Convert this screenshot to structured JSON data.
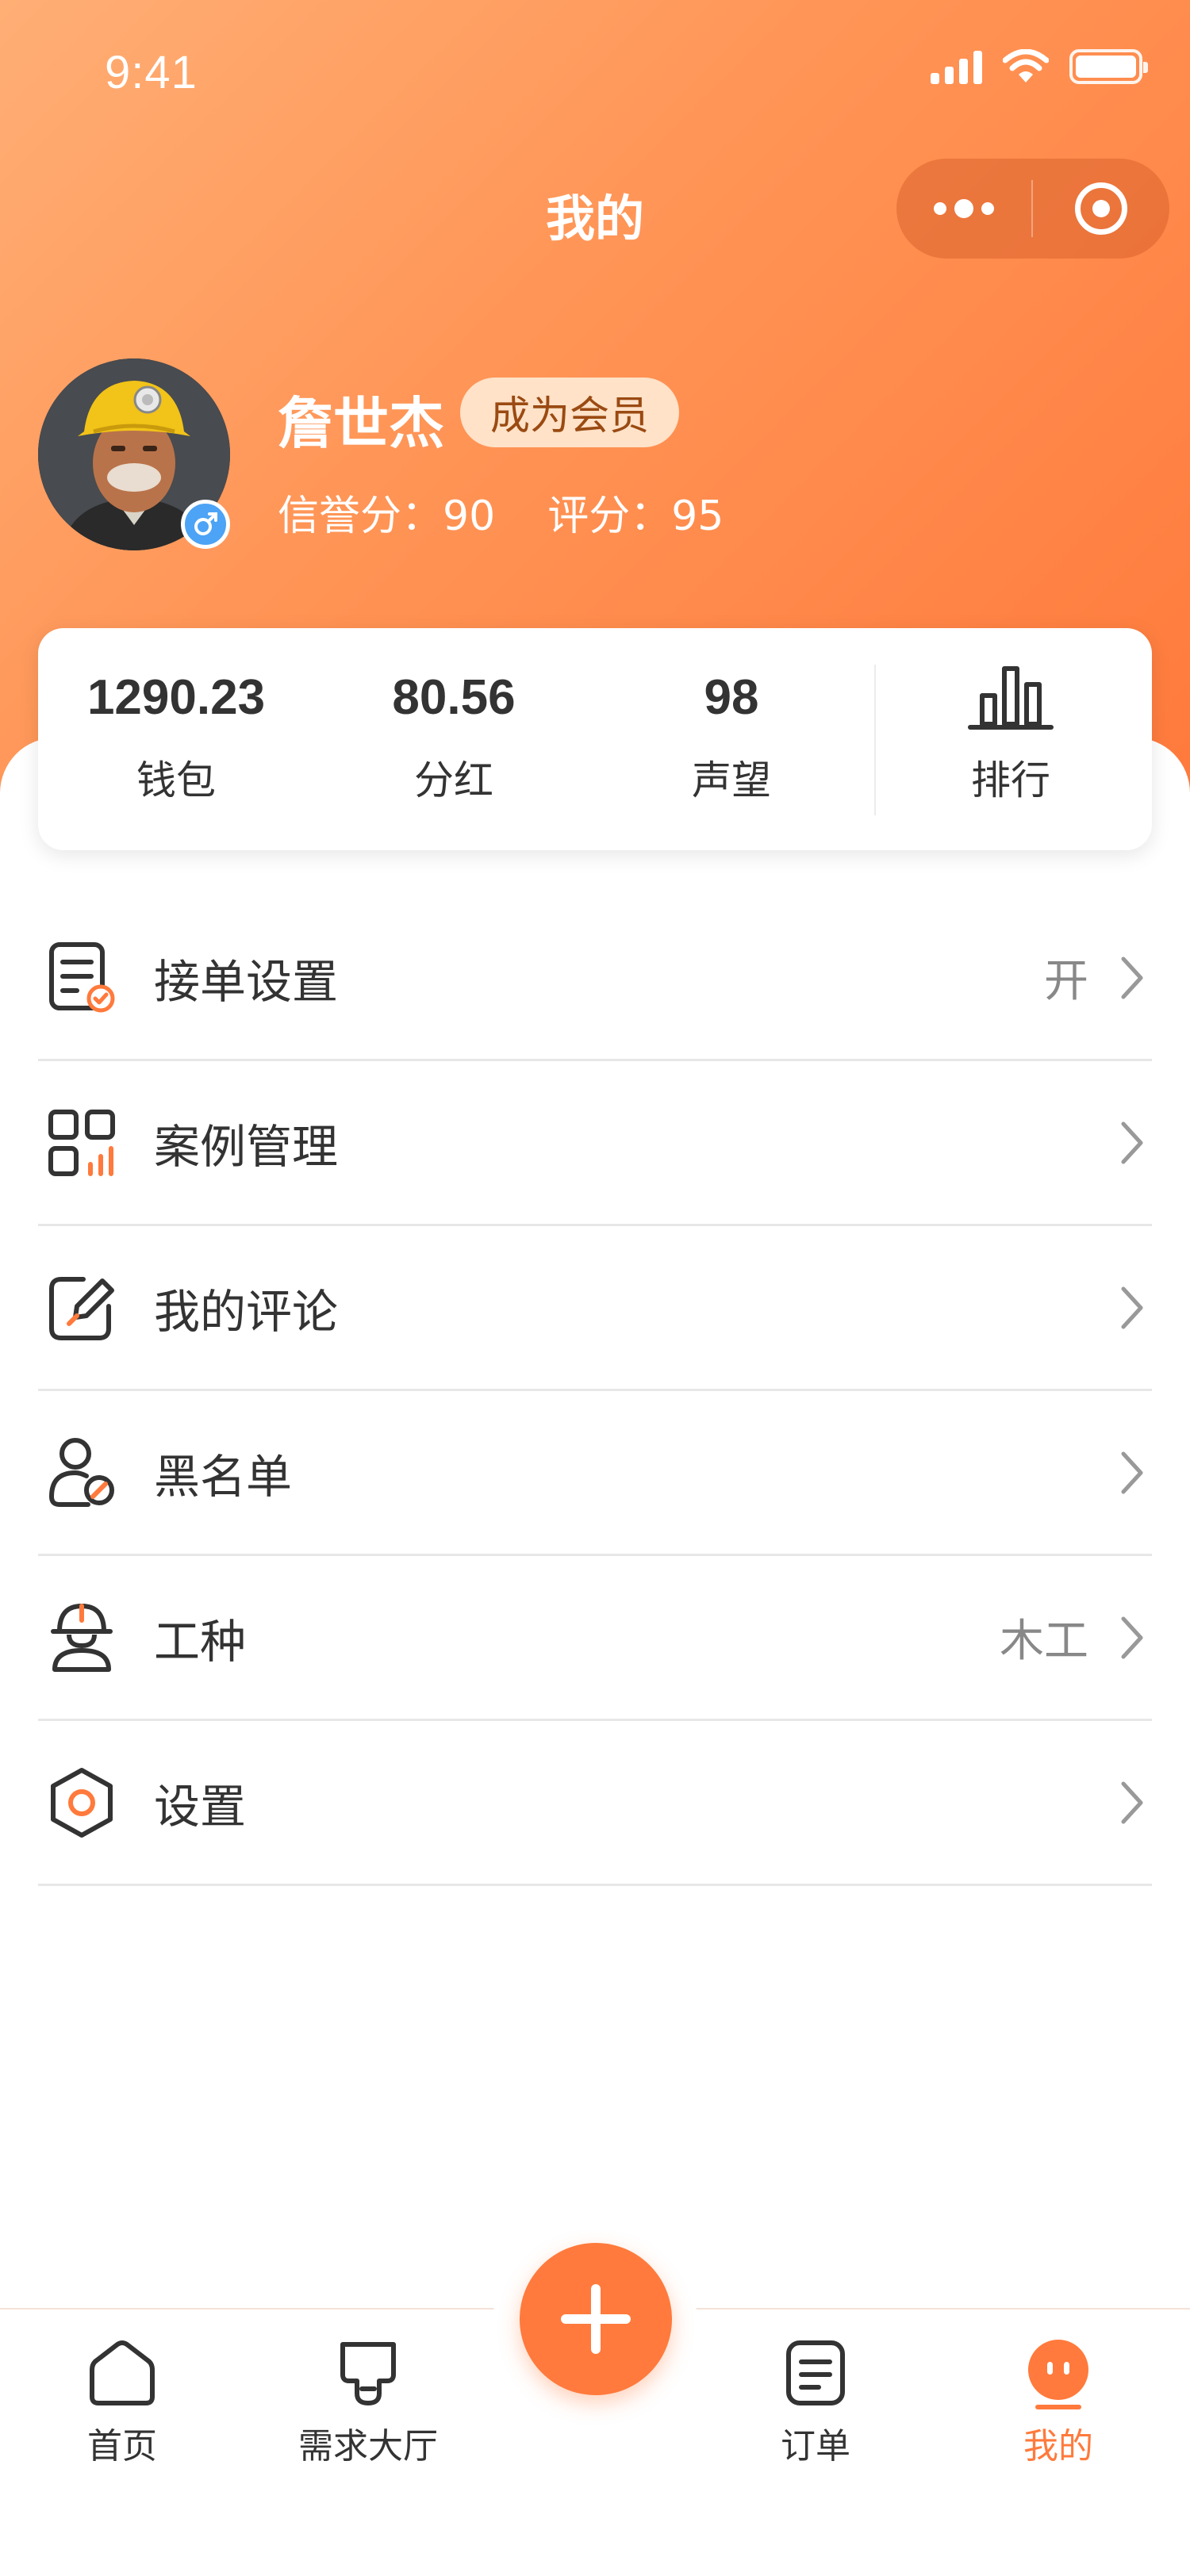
{
  "status_bar": {
    "time": "9:41"
  },
  "nav": {
    "title": "我的"
  },
  "profile": {
    "name": "詹世杰",
    "vip_label": "成为会员",
    "credit_label": "信誉分：",
    "credit_value": "90",
    "rating_label": "评分：",
    "rating_value": "95"
  },
  "stats": [
    {
      "value": "1290.23",
      "label": "钱包"
    },
    {
      "value": "80.56",
      "label": "分红"
    },
    {
      "value": "98",
      "label": "声望"
    }
  ],
  "ranking": {
    "label": "排行",
    "icon": "bar-chart-icon"
  },
  "menu": [
    {
      "label": "接单设置",
      "value": "开",
      "icon": "order-settings-icon"
    },
    {
      "label": "案例管理",
      "value": "",
      "icon": "case-grid-icon"
    },
    {
      "label": "我的评论",
      "value": "",
      "icon": "edit-comment-icon"
    },
    {
      "label": "黑名单",
      "value": "",
      "icon": "blocked-user-icon"
    },
    {
      "label": "工种",
      "value": "木工",
      "icon": "worker-helmet-icon"
    },
    {
      "label": "设置",
      "value": "",
      "icon": "hex-settings-icon"
    }
  ],
  "tabs": [
    {
      "label": "首页",
      "icon": "home-icon"
    },
    {
      "label": "需求大厅",
      "icon": "demand-hall-icon"
    },
    {
      "label": "订单",
      "icon": "order-list-icon"
    },
    {
      "label": "我的",
      "icon": "mine-icon",
      "active": true
    }
  ],
  "colors": {
    "accent": "#ff7a3c",
    "header_start": "#ffae75",
    "header_end": "#ff7a3c",
    "vip_bg": "#ffe2c8"
  }
}
